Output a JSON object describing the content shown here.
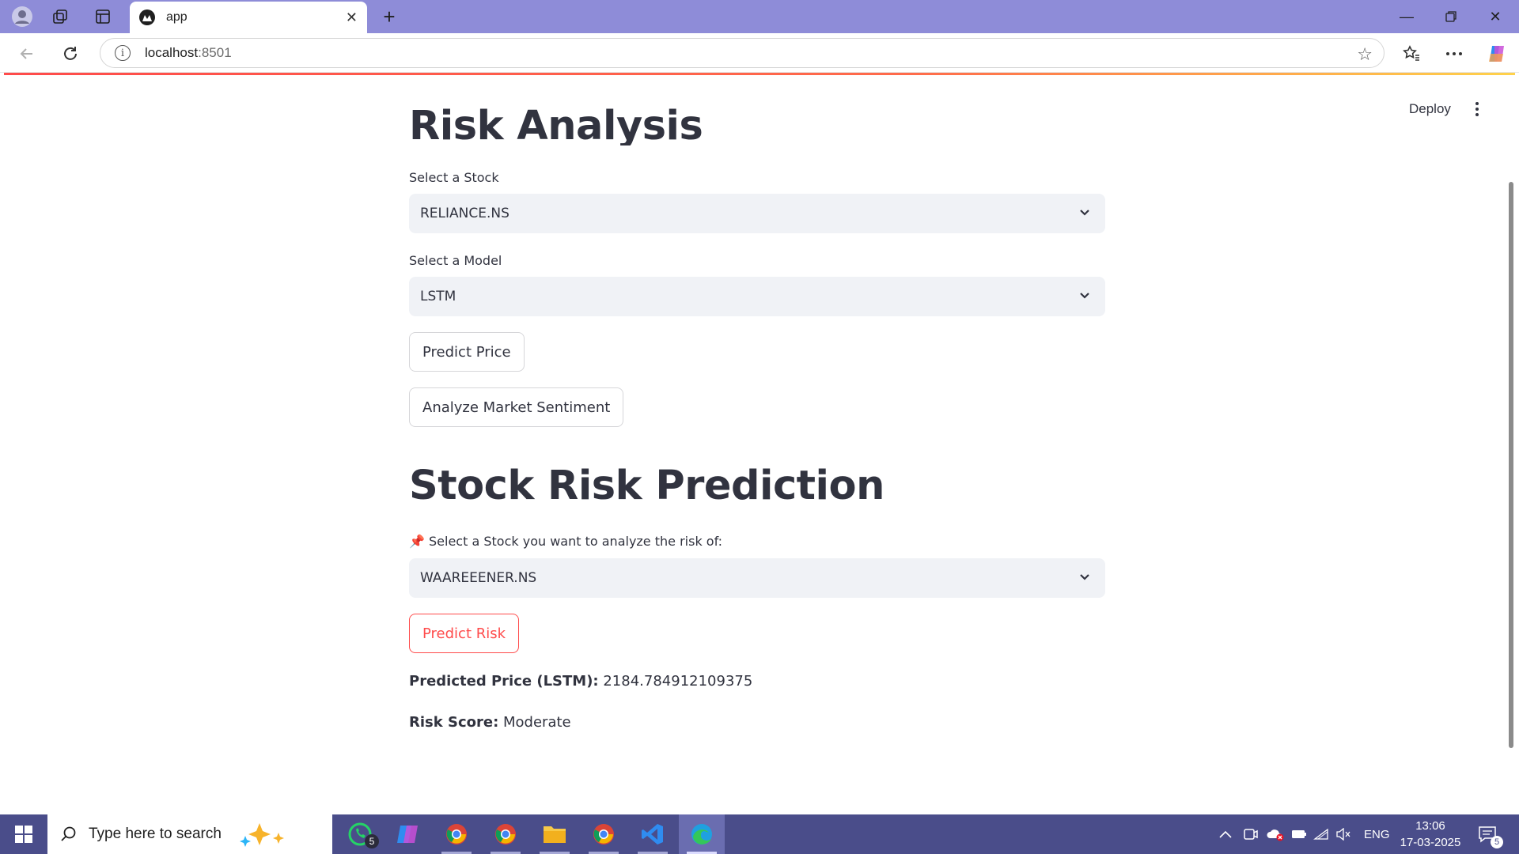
{
  "browser": {
    "tab_title": "app",
    "url_host": "localhost",
    "url_port": ":8501"
  },
  "app": {
    "deploy_label": "Deploy",
    "partial_heading": "Risk Analysis",
    "stock_label": "Select a Stock",
    "stock_value": "RELIANCE.NS",
    "model_label": "Select a Model",
    "model_value": "LSTM",
    "predict_price_button": "Predict Price",
    "sentiment_button": "Analyze Market Sentiment",
    "risk_heading": "Stock Risk Prediction",
    "risk_stock_emoji": "📌",
    "risk_stock_label": "Select a Stock you want to analyze the risk of:",
    "risk_stock_value": "WAAREEENER.NS",
    "predict_risk_button": "Predict Risk",
    "predicted_price_key": "Predicted Price (LSTM):",
    "predicted_price_value": "2184.784912109375",
    "risk_score_key": "Risk Score:",
    "risk_score_value": "Moderate"
  },
  "taskbar": {
    "search_placeholder": "Type here to search",
    "whatsapp_badge": "5",
    "language": "ENG",
    "time": "13:06",
    "date": "17-03-2025",
    "notification_count": "5"
  },
  "colors": {
    "accent": "#ff4b4b",
    "tabstrip": "#8e8cd8",
    "taskbar": "#4a4d8a",
    "select_bg": "#f0f2f6"
  }
}
